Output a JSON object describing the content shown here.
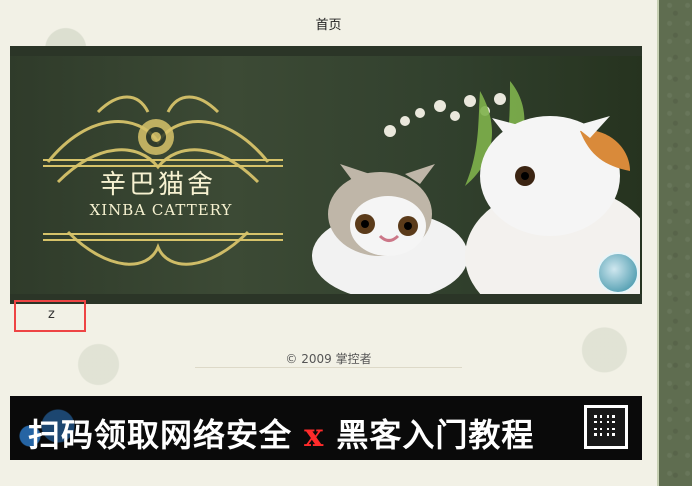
{
  "nav": {
    "home_label": "首页"
  },
  "banner": {
    "title_cn": "辛巴猫舍",
    "title_en": "XINBA CATTERY"
  },
  "highlight": {
    "char": "z"
  },
  "footer": {
    "copyright": "© 2009 掌控者"
  },
  "ad": {
    "text_left": "扫码领取网络安全",
    "x": "x",
    "text_right": "黑客入门教程"
  },
  "colors": {
    "page_bg": "#f2f1e6",
    "outer_bg": "#5f6d50",
    "highlight_border": "#e44"
  }
}
